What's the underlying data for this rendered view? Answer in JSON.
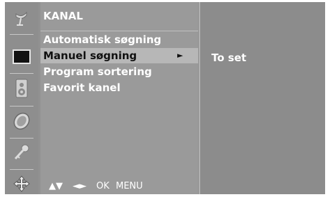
{
  "sidebar": {
    "icons": [
      {
        "name": "satellite-dish-icon",
        "selected": false
      },
      {
        "name": "screen-icon",
        "selected": true
      },
      {
        "name": "speaker-icon",
        "selected": false
      },
      {
        "name": "clock-icon",
        "selected": false
      },
      {
        "name": "key-icon",
        "selected": false
      },
      {
        "name": "cross-arrows-icon",
        "selected": false
      }
    ]
  },
  "menu": {
    "title": "KANAL",
    "items": [
      {
        "label": "Automatisk søgning",
        "selected": false
      },
      {
        "label": "Manuel søgning",
        "selected": true,
        "arrow": "►"
      },
      {
        "label": "Program sortering",
        "selected": false
      },
      {
        "label": "Favorit kanel",
        "selected": false
      }
    ],
    "footer": {
      "nav_updown": "▲▼",
      "nav_leftright": "◄►",
      "ok": "OK",
      "menu": "MENU"
    }
  },
  "submenu": {
    "label": "To set"
  },
  "colors": {
    "background": "#919191",
    "highlight": "#b7b7b7",
    "text": "#ffffff",
    "selected_text": "#111111"
  }
}
